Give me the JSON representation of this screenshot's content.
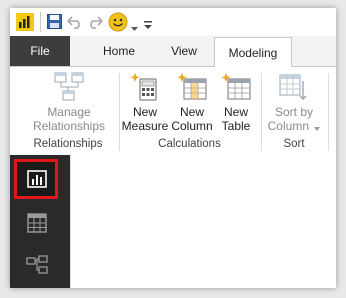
{
  "ribbon_tabs": {
    "file": "File",
    "home": "Home",
    "view": "View",
    "modeling": "Modeling"
  },
  "groups": {
    "relationships": {
      "label": "Relationships",
      "manage_line1": "Manage",
      "manage_line2": "Relationships"
    },
    "calculations": {
      "label": "Calculations",
      "new_measure_line1": "New",
      "new_measure_line2": "Measure",
      "new_column_line1": "New",
      "new_column_line2": "Column",
      "new_table_line1": "New",
      "new_table_line2": "Table"
    },
    "sort": {
      "label": "Sort",
      "sort_by_line1": "Sort by",
      "sort_by_line2": "Column"
    }
  },
  "nav": {
    "items": [
      "report-view",
      "data-view",
      "relationships-view"
    ],
    "selected": "report-view"
  },
  "colors": {
    "app_icon": "#f2c811",
    "file_tab": "#3d3d3d",
    "nav_bg": "#2a2a2a",
    "selected_outline": "#e0161a"
  }
}
